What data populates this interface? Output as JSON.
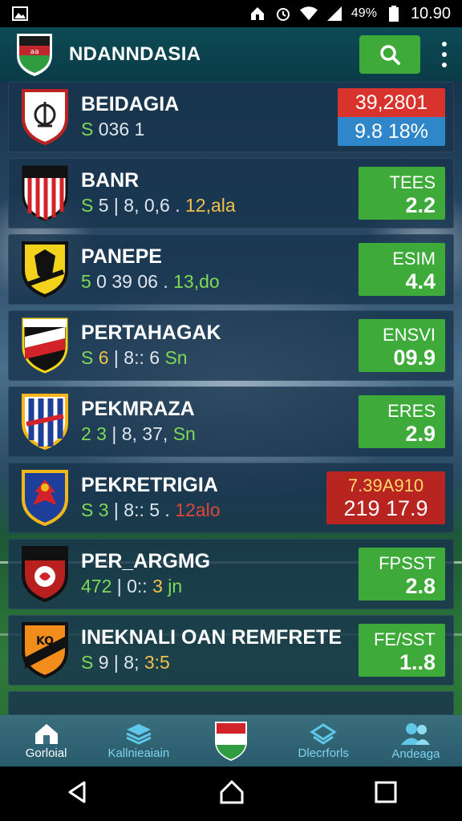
{
  "status_bar": {
    "battery": "49%",
    "time": "10.90"
  },
  "app_bar": {
    "title": "NDANNDASIA"
  },
  "teams": [
    {
      "name": "BEIDAGIA",
      "stats": [
        {
          "t": "S",
          "c": "s"
        },
        {
          "t": " 036  1",
          "c": ""
        }
      ],
      "odds_type": "split",
      "odds_top": "39,2801",
      "odds_bottom": "9.8  18%"
    },
    {
      "name": "BANR",
      "stats": [
        {
          "t": "S",
          "c": "s"
        },
        {
          "t": "  5 | 8, 0,6  . ",
          "c": ""
        },
        {
          "t": "12,ala",
          "c": "y"
        }
      ],
      "odds_type": "green",
      "odds_label": "TEES",
      "odds_value": "2.2"
    },
    {
      "name": "PANEPE",
      "stats": [
        {
          "t": "5",
          "c": "s"
        },
        {
          "t": "  0  39  06  . ",
          "c": ""
        },
        {
          "t": "13,do",
          "c": "s"
        }
      ],
      "odds_type": "green",
      "odds_label": "ESIM",
      "odds_value": "4.4"
    },
    {
      "name": "PERTAHAGAK",
      "stats": [
        {
          "t": "S",
          "c": "s"
        },
        {
          "t": "  ",
          "c": ""
        },
        {
          "t": "6",
          "c": "y"
        },
        {
          "t": " | 8::  6  ",
          "c": ""
        },
        {
          "t": "Sn",
          "c": "s"
        }
      ],
      "odds_type": "green",
      "odds_label": "ENSVI",
      "odds_value": "09.9"
    },
    {
      "name": "PEKMRAZA",
      "stats": [
        {
          "t": "2  3",
          "c": "s"
        },
        {
          "t": " | 8, 37,  ",
          "c": ""
        },
        {
          "t": "Sn",
          "c": "s"
        }
      ],
      "odds_type": "green",
      "odds_label": "ERES",
      "odds_value": "2.9"
    },
    {
      "name": "PEKRETRIGIA",
      "stats": [
        {
          "t": "S  3",
          "c": "s"
        },
        {
          "t": " | 8::  5  . ",
          "c": ""
        },
        {
          "t": "12alo",
          "c": "r"
        }
      ],
      "odds_type": "red",
      "odds_top": "7.39A910",
      "odds_bottom": "219  17.9"
    },
    {
      "name": "PER_ARGMG",
      "stats": [
        {
          "t": "472",
          "c": "s"
        },
        {
          "t": " | 0::  ",
          "c": ""
        },
        {
          "t": "3",
          "c": "y"
        },
        {
          "t": "  jn",
          "c": "s"
        }
      ],
      "odds_type": "green",
      "odds_label": "FPSST",
      "odds_value": "2.8"
    },
    {
      "name": "INEKNALI OAN REMFRETE",
      "stats": [
        {
          "t": "S",
          "c": "s"
        },
        {
          "t": "  9 | 8; ",
          "c": ""
        },
        {
          "t": "3:5",
          "c": "y"
        }
      ],
      "odds_type": "green",
      "odds_label": "FE/SST",
      "odds_value": "1..8"
    }
  ],
  "bottom_nav": [
    {
      "label": "Gorloial",
      "icon": "home-icon"
    },
    {
      "label": "Kallnieaiain",
      "icon": "stack-icon"
    },
    {
      "label": "",
      "icon": "hungary-shield-icon"
    },
    {
      "label": "Dlecrforls",
      "icon": "layers-icon"
    },
    {
      "label": "Andeaga",
      "icon": "users-icon"
    }
  ],
  "colors": {
    "accent_green": "#3daa3a",
    "odds_red": "#b8241f",
    "odds_blue": "#2f86c9",
    "app_bar": "#0c4a55"
  }
}
